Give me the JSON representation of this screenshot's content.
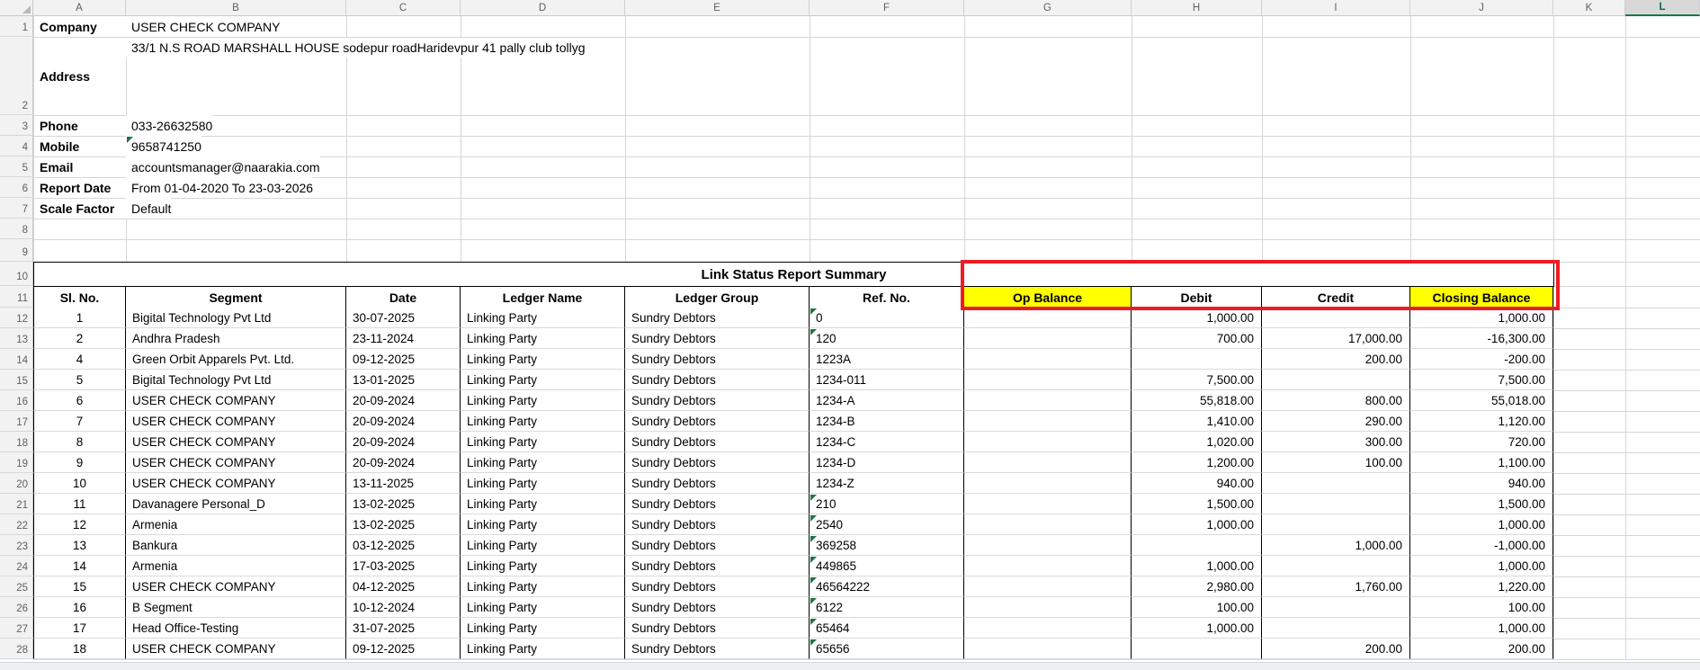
{
  "sheet": {
    "column_letters": [
      "A",
      "B",
      "C",
      "D",
      "E",
      "F",
      "G",
      "H",
      "I",
      "J",
      "K",
      "L"
    ],
    "selected_column": "L",
    "visible_row_count": 28
  },
  "info": {
    "rows": [
      {
        "key": "company",
        "label": "Company",
        "value": "USER CHECK COMPANY",
        "flag": false
      },
      {
        "key": "address",
        "label": "Address",
        "value": "33/1 N.S ROAD MARSHALL HOUSE sodepur roadHaridevpur 41 pally club tollyg",
        "flag": false
      },
      {
        "key": "phone",
        "label": "Phone",
        "value": "033-26632580",
        "flag": false
      },
      {
        "key": "mobile",
        "label": "Mobile",
        "value": "9658741250",
        "flag": true
      },
      {
        "key": "email",
        "label": "Email",
        "value": "accountsmanager@naarakia.com",
        "flag": false
      },
      {
        "key": "report-date",
        "label": "Report Date",
        "value": "From 01-04-2020 To 23-03-2026",
        "flag": false
      },
      {
        "key": "scale-factor",
        "label": "Scale Factor",
        "value": "Default",
        "flag": false
      }
    ]
  },
  "report": {
    "title": "Link Status Report Summary",
    "columns": [
      {
        "key": "sl",
        "label": "Sl. No.",
        "align": "center",
        "highlight": false
      },
      {
        "key": "segment",
        "label": "Segment",
        "align": "left",
        "highlight": false
      },
      {
        "key": "date",
        "label": "Date",
        "align": "left",
        "highlight": false
      },
      {
        "key": "ledger_name",
        "label": "Ledger Name",
        "align": "left",
        "highlight": false
      },
      {
        "key": "ledger_group",
        "label": "Ledger Group",
        "align": "left",
        "highlight": false
      },
      {
        "key": "ref",
        "label": "Ref. No.",
        "align": "left",
        "highlight": false
      },
      {
        "key": "op",
        "label": "Op Balance",
        "align": "right",
        "highlight": true
      },
      {
        "key": "debit",
        "label": "Debit",
        "align": "right",
        "highlight": false
      },
      {
        "key": "credit",
        "label": "Credit",
        "align": "right",
        "highlight": false
      },
      {
        "key": "closing",
        "label": "Closing Balance",
        "align": "right",
        "highlight": true
      }
    ],
    "rows": [
      {
        "sl": "1",
        "segment": "Bigital Technology Pvt Ltd",
        "date": "30-07-2025",
        "ledger_name": "Linking Party",
        "ledger_group": "Sundry Debtors",
        "ref": "0",
        "ref_flag": true,
        "op": "",
        "debit": "1,000.00",
        "credit": "",
        "closing": "1,000.00"
      },
      {
        "sl": "2",
        "segment": "Andhra Pradesh",
        "date": "23-11-2024",
        "ledger_name": "Linking Party",
        "ledger_group": "Sundry Debtors",
        "ref": "120",
        "ref_flag": true,
        "op": "",
        "debit": "700.00",
        "credit": "17,000.00",
        "closing": "-16,300.00"
      },
      {
        "sl": "4",
        "segment": "Green Orbit Apparels Pvt. Ltd.",
        "date": "09-12-2025",
        "ledger_name": "Linking Party",
        "ledger_group": "Sundry Debtors",
        "ref": "1223A",
        "ref_flag": false,
        "op": "",
        "debit": "",
        "credit": "200.00",
        "closing": "-200.00"
      },
      {
        "sl": "5",
        "segment": "Bigital Technology Pvt Ltd",
        "date": "13-01-2025",
        "ledger_name": "Linking Party",
        "ledger_group": "Sundry Debtors",
        "ref": "1234-011",
        "ref_flag": false,
        "op": "",
        "debit": "7,500.00",
        "credit": "",
        "closing": "7,500.00"
      },
      {
        "sl": "6",
        "segment": "USER CHECK COMPANY",
        "date": "20-09-2024",
        "ledger_name": "Linking Party",
        "ledger_group": "Sundry Debtors",
        "ref": "1234-A",
        "ref_flag": false,
        "op": "",
        "debit": "55,818.00",
        "credit": "800.00",
        "closing": "55,018.00"
      },
      {
        "sl": "7",
        "segment": "USER CHECK COMPANY",
        "date": "20-09-2024",
        "ledger_name": "Linking Party",
        "ledger_group": "Sundry Debtors",
        "ref": "1234-B",
        "ref_flag": false,
        "op": "",
        "debit": "1,410.00",
        "credit": "290.00",
        "closing": "1,120.00"
      },
      {
        "sl": "8",
        "segment": "USER CHECK COMPANY",
        "date": "20-09-2024",
        "ledger_name": "Linking Party",
        "ledger_group": "Sundry Debtors",
        "ref": "1234-C",
        "ref_flag": false,
        "op": "",
        "debit": "1,020.00",
        "credit": "300.00",
        "closing": "720.00"
      },
      {
        "sl": "9",
        "segment": "USER CHECK COMPANY",
        "date": "20-09-2024",
        "ledger_name": "Linking Party",
        "ledger_group": "Sundry Debtors",
        "ref": "1234-D",
        "ref_flag": false,
        "op": "",
        "debit": "1,200.00",
        "credit": "100.00",
        "closing": "1,100.00"
      },
      {
        "sl": "10",
        "segment": "USER CHECK COMPANY",
        "date": "13-11-2025",
        "ledger_name": "Linking Party",
        "ledger_group": "Sundry Debtors",
        "ref": "1234-Z",
        "ref_flag": false,
        "op": "",
        "debit": "940.00",
        "credit": "",
        "closing": "940.00"
      },
      {
        "sl": "11",
        "segment": "Davanagere Personal_D",
        "date": "13-02-2025",
        "ledger_name": "Linking Party",
        "ledger_group": "Sundry Debtors",
        "ref": "210",
        "ref_flag": true,
        "op": "",
        "debit": "1,500.00",
        "credit": "",
        "closing": "1,500.00"
      },
      {
        "sl": "12",
        "segment": "Armenia",
        "date": "13-02-2025",
        "ledger_name": "Linking Party",
        "ledger_group": "Sundry Debtors",
        "ref": "2540",
        "ref_flag": true,
        "op": "",
        "debit": "1,000.00",
        "credit": "",
        "closing": "1,000.00"
      },
      {
        "sl": "13",
        "segment": "Bankura",
        "date": "03-12-2025",
        "ledger_name": "Linking Party",
        "ledger_group": "Sundry Debtors",
        "ref": "369258",
        "ref_flag": true,
        "op": "",
        "debit": "",
        "credit": "1,000.00",
        "closing": "-1,000.00"
      },
      {
        "sl": "14",
        "segment": "Armenia",
        "date": "17-03-2025",
        "ledger_name": "Linking Party",
        "ledger_group": "Sundry Debtors",
        "ref": "449865",
        "ref_flag": true,
        "op": "",
        "debit": "1,000.00",
        "credit": "",
        "closing": "1,000.00"
      },
      {
        "sl": "15",
        "segment": "USER CHECK COMPANY",
        "date": "04-12-2025",
        "ledger_name": "Linking Party",
        "ledger_group": "Sundry Debtors",
        "ref": "46564222",
        "ref_flag": true,
        "op": "",
        "debit": "2,980.00",
        "credit": "1,760.00",
        "closing": "1,220.00"
      },
      {
        "sl": "16",
        "segment": "B Segment",
        "date": "10-12-2024",
        "ledger_name": "Linking Party",
        "ledger_group": "Sundry Debtors",
        "ref": "6122",
        "ref_flag": true,
        "op": "",
        "debit": "100.00",
        "credit": "",
        "closing": "100.00"
      },
      {
        "sl": "17",
        "segment": "Head Office-Testing",
        "date": "31-07-2025",
        "ledger_name": "Linking Party",
        "ledger_group": "Sundry Debtors",
        "ref": "65464",
        "ref_flag": true,
        "op": "",
        "debit": "1,000.00",
        "credit": "",
        "closing": "1,000.00"
      },
      {
        "sl": "18",
        "segment": "USER CHECK COMPANY",
        "date": "09-12-2025",
        "ledger_name": "Linking Party",
        "ledger_group": "Sundry Debtors",
        "ref": "65656",
        "ref_flag": true,
        "op": "",
        "debit": "",
        "credit": "200.00",
        "closing": "200.00"
      }
    ]
  },
  "colors": {
    "header_highlight": "#ffff00",
    "annotation_box": "#ed1c24",
    "selected_column_accent": "#107c41",
    "text_flag_triangle": "#217346"
  }
}
